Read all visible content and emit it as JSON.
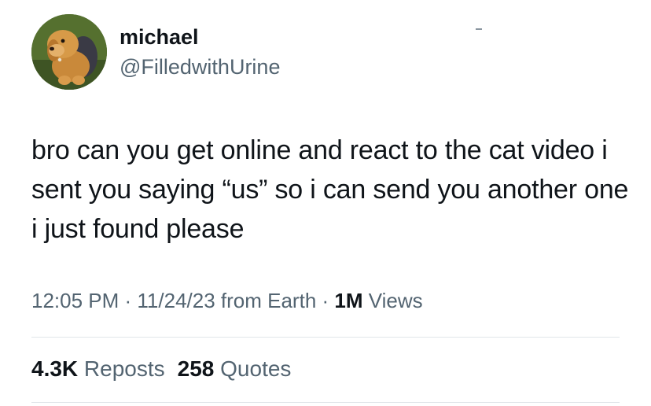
{
  "author": {
    "display_name": "michael",
    "handle": "@FilledwithUrine",
    "avatar_icon": "plush-dog-avatar"
  },
  "tweet": {
    "text": "bro can you get online and react to the cat video i sent you saying “us” so i can send you another one i just found please"
  },
  "meta": {
    "time": "12:05 PM",
    "separator1": " · ",
    "date": "11/24/23",
    "source": " from Earth",
    "separator2": " · ",
    "views_count": "1M",
    "views_label": " Views"
  },
  "stats": {
    "reposts_count": "4.3K",
    "reposts_label": " Reposts",
    "quotes_count": "258",
    "quotes_label": " Quotes"
  },
  "colors": {
    "text_primary": "#0f1419",
    "text_secondary": "#536471",
    "divider": "#e1e6ea"
  }
}
